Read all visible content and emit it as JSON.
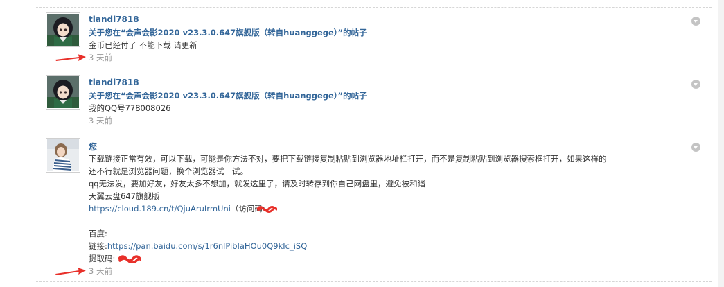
{
  "notifications": [
    {
      "sender": "tiandi7818",
      "subject": "关于您在“会声会影2020 v23.3.0.647旗舰版（转自huanggege）”的帖子",
      "body_lines": [
        "金币已经付了 不能下载  请更新"
      ],
      "time": "3 天前",
      "avatar": "anime-character-avatar"
    },
    {
      "sender": "tiandi7818",
      "subject": "关于您在“会声会影2020 v23.3.0.647旗舰版（转自huanggege）”的帖子",
      "body_lines": [
        "我的QQ号778008026"
      ],
      "time": "3 天前",
      "avatar": "anime-character-avatar"
    },
    {
      "sender": "您",
      "body_lines": [
        "下载链接正常有效，可以下载，可能是你方法不对，要把下载链接复制粘贴到浏览器地址栏打开，而不是复制粘贴到浏览器搜索框打开，如果这样的",
        "还不行就是浏览器问题，换个浏览器试一试。",
        "qq无法发，要加好友，好友太多不想加，就发这里了，请及时转存到你自己网盘里，避免被和谐",
        "天翼云盘647旗舰版",
        "https://cloud.189.cn/t/QjuAruIrmUni",
        "（访问码:",
        "百度:",
        "链接:",
        "https://pan.baidu.com/s/1r6nlPibIaHOu0Q9kIc_iSQ",
        "提取码:"
      ],
      "time": "3 天前",
      "avatar": "girl-photo-avatar"
    }
  ],
  "icons": {
    "menu_toggle": "chevron-down-circle-icon",
    "annotation": "red-arrow-icon",
    "redaction": "red-scribble-redaction"
  },
  "colors": {
    "link_blue": "#336699",
    "time_gray": "#999999",
    "annotation_red": "#e8302a"
  }
}
